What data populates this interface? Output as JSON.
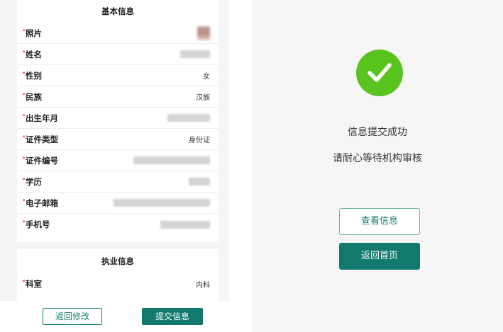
{
  "form": {
    "basic_title": "基本信息",
    "rows": [
      {
        "label": "照片",
        "value": ""
      },
      {
        "label": "姓名",
        "value": ""
      },
      {
        "label": "性别",
        "value": "女"
      },
      {
        "label": "民族",
        "value": "汉族"
      },
      {
        "label": "出生年月",
        "value": ""
      },
      {
        "label": "证件类型",
        "value": "身份证"
      },
      {
        "label": "证件编号",
        "value": ""
      },
      {
        "label": "学历",
        "value": ""
      },
      {
        "label": "电子邮箱",
        "value": ""
      },
      {
        "label": "手机号",
        "value": ""
      }
    ],
    "practice_title": "执业信息",
    "practice_rows": [
      {
        "label": "科室",
        "value": "内科"
      }
    ],
    "required_mark": "•"
  },
  "actions": {
    "back_edit": "返回修改",
    "submit": "提交信息"
  },
  "result": {
    "title": "信息提交成功",
    "subtitle": "请耐心等待机构审核",
    "view_button": "查看信息",
    "home_button": "返回首页"
  },
  "colors": {
    "primary": "#117a6d",
    "success": "#5ac41f",
    "required": "#e04040"
  },
  "icons": {
    "success": "check-icon"
  }
}
